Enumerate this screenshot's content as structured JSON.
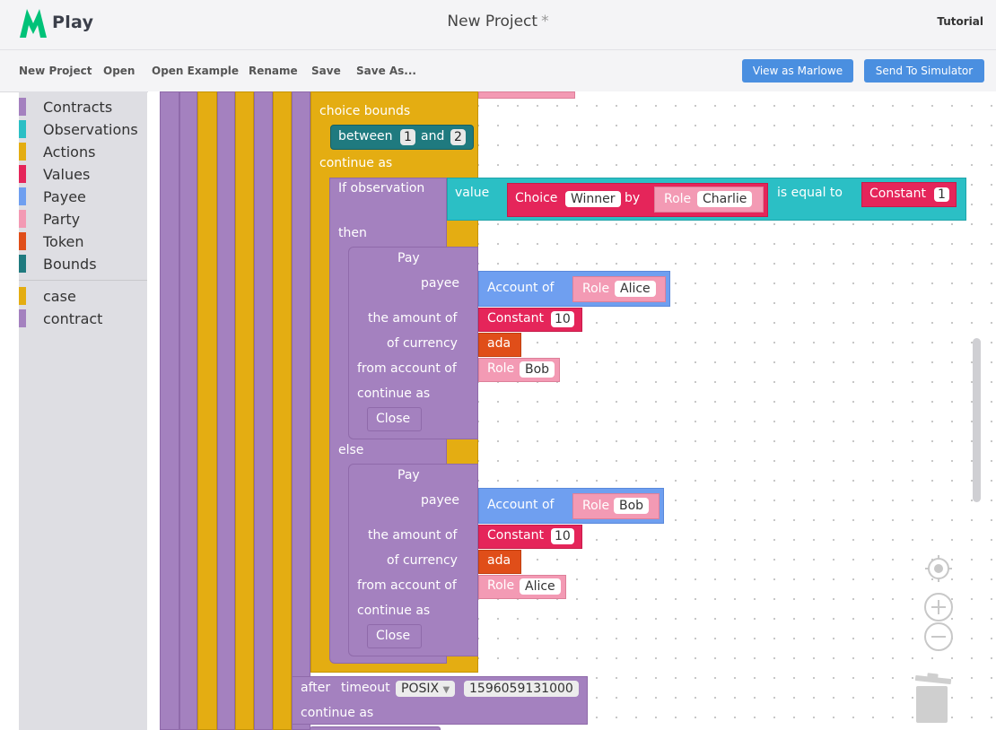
{
  "app": {
    "name": "Play",
    "brand_color": "#00c278"
  },
  "header": {
    "title": "New Project",
    "unsaved_marker": "*",
    "tutorial_label": "Tutorial"
  },
  "toolbar": {
    "menu": [
      "New Project",
      "Open",
      "Open Example",
      "Rename",
      "Save",
      "Save As..."
    ],
    "view_as_label": "View as Marlowe",
    "send_label": "Send To Simulator",
    "button_color": "#4a8fe0"
  },
  "toolbox": {
    "categories": [
      {
        "label": "Contracts",
        "color": "#a481bf"
      },
      {
        "label": "Observations",
        "color": "#2bbfc5"
      },
      {
        "label": "Actions",
        "color": "#e4ad12"
      },
      {
        "label": "Values",
        "color": "#e5255a"
      },
      {
        "label": "Payee",
        "color": "#6f9ff0"
      },
      {
        "label": "Party",
        "color": "#f39ab4"
      },
      {
        "label": "Token",
        "color": "#e04e19"
      },
      {
        "label": "Bounds",
        "color": "#1f7a7f"
      }
    ],
    "blocks": [
      {
        "label": "case",
        "color": "#e4ad12"
      },
      {
        "label": "contract",
        "color": "#a481bf"
      }
    ]
  },
  "workspace": {
    "choice_bounds_label": "choice bounds",
    "between_label": "between",
    "bound_from": "1",
    "and_label": "and",
    "bound_to": "2",
    "continue_as_label": "continue as",
    "if_observation_label": "If observation",
    "value_label": "value",
    "choice_label": "Choice",
    "choice_name": "Winner",
    "by_label": "by",
    "role_label": "Role",
    "choice_owner": "Charlie",
    "is_equal_label": "is equal to",
    "constant_label": "Constant",
    "constant_compare": "1",
    "then_label": "then",
    "else_label": "else",
    "pay_label": "Pay",
    "payee_label": "payee",
    "account_of_label": "Account of",
    "amount_label": "the amount of",
    "currency_label": "of currency",
    "from_account_label": "from account of",
    "close_label": "Close",
    "pay_then": {
      "payee_role": "Alice",
      "amount": "10",
      "token": "ada",
      "from_role": "Bob"
    },
    "pay_else": {
      "payee_role": "Bob",
      "amount": "10",
      "token": "ada",
      "from_role": "Alice"
    },
    "after_label": "after",
    "timeout_label": "timeout",
    "timeout_type": "POSIX",
    "timeout_value": "1596059131000"
  },
  "controls": {
    "recenter_icon": "crosshair-icon",
    "zoom_in_icon": "zoom-in-icon",
    "zoom_out_icon": "zoom-out-icon",
    "trash_icon": "trash-icon"
  }
}
